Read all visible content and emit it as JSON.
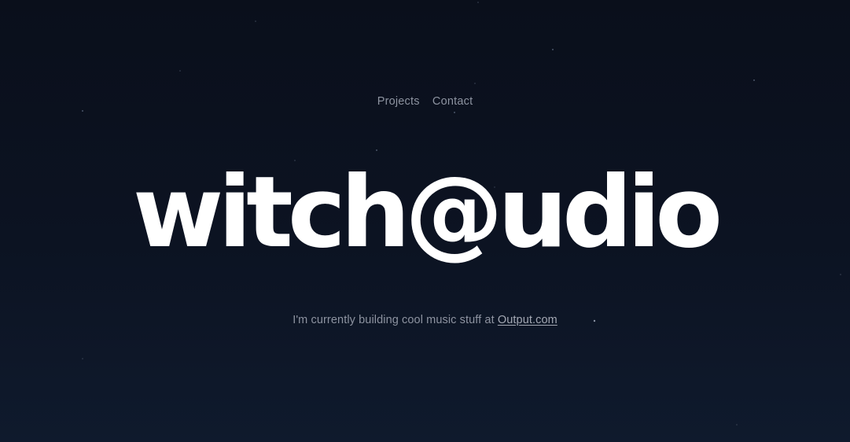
{
  "nav": {
    "items": [
      {
        "label": "Projects"
      },
      {
        "label": "Contact"
      }
    ]
  },
  "hero": {
    "title": "witch@udio"
  },
  "tagline": {
    "text": "I'm currently building cool music stuff at",
    "link_label": "Output.com"
  },
  "colors": {
    "background_top": "#0a0f1b",
    "background_bottom": "#0f1a2d",
    "title": "#ffffff",
    "muted_text": "#8d93a0"
  }
}
